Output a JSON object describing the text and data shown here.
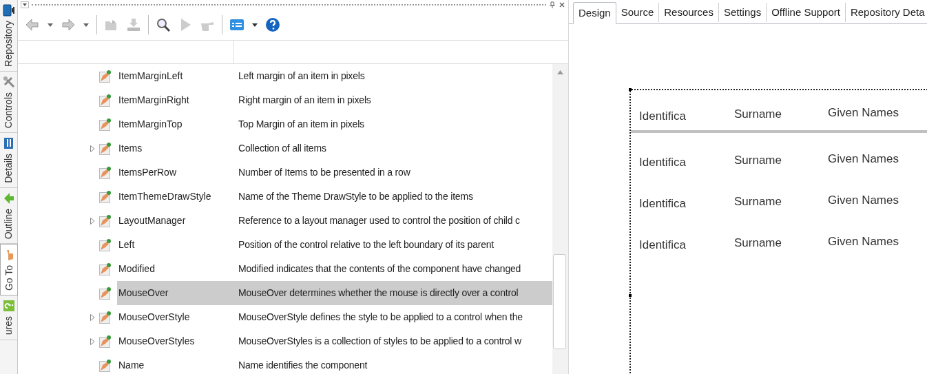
{
  "side_tabs": [
    {
      "label": "Repository",
      "selected": false
    },
    {
      "label": "Controls",
      "selected": false
    },
    {
      "label": "Details",
      "selected": false
    },
    {
      "label": "Outline",
      "selected": false
    },
    {
      "label": "Go To",
      "selected": true
    },
    {
      "label": "ures",
      "selected": false
    }
  ],
  "properties": {
    "rows": [
      {
        "name": "ItemMarginLeft",
        "description": "Left margin of an item in pixels",
        "expandable": false,
        "selected": false
      },
      {
        "name": "ItemMarginRight",
        "description": "Right margin of an item in pixels",
        "expandable": false,
        "selected": false
      },
      {
        "name": "ItemMarginTop",
        "description": "Top Margin of an item in pixels",
        "expandable": false,
        "selected": false
      },
      {
        "name": "Items",
        "description": "Collection of all items",
        "expandable": true,
        "selected": false
      },
      {
        "name": "ItemsPerRow",
        "description": "Number of Items to be presented in a row",
        "expandable": false,
        "selected": false
      },
      {
        "name": "ItemThemeDrawStyle",
        "description": "Name of the Theme DrawStyle to be applied to the items",
        "expandable": false,
        "selected": false
      },
      {
        "name": "LayoutManager",
        "description": "Reference to a layout manager used to control the position of child c",
        "expandable": true,
        "selected": false
      },
      {
        "name": "Left",
        "description": "Position of the control relative to the left boundary of its parent",
        "expandable": false,
        "selected": false
      },
      {
        "name": "Modified",
        "description": "Modified indicates that the contents of the component have changed",
        "expandable": false,
        "selected": false
      },
      {
        "name": "MouseOver",
        "description": "MouseOver determines whether the mouse is directly over a control",
        "expandable": false,
        "selected": true
      },
      {
        "name": "MouseOverStyle",
        "description": "MouseOverStyle defines the style to be applied to a control when the",
        "expandable": true,
        "selected": false
      },
      {
        "name": "MouseOverStyles",
        "description": "MouseOverStyles is a collection of styles to be applied to a control w",
        "expandable": true,
        "selected": false
      },
      {
        "name": "Name",
        "description": "Name identifies the component",
        "expandable": false,
        "selected": false
      }
    ]
  },
  "editor_tabs": [
    {
      "label": "Design",
      "selected": true
    },
    {
      "label": "Source",
      "selected": false
    },
    {
      "label": "Resources",
      "selected": false
    },
    {
      "label": "Settings",
      "selected": false
    },
    {
      "label": "Offline Support",
      "selected": false
    },
    {
      "label": "Repository Deta",
      "selected": false
    }
  ],
  "grid": {
    "columns": [
      "Identifica",
      "Surname",
      "Given Names"
    ],
    "rows": [
      [
        "Identifica",
        "Surname",
        "Given Names"
      ],
      [
        "Identifica",
        "Surname",
        "Given Names"
      ],
      [
        "Identifica",
        "Surname",
        "Given Names"
      ]
    ]
  }
}
